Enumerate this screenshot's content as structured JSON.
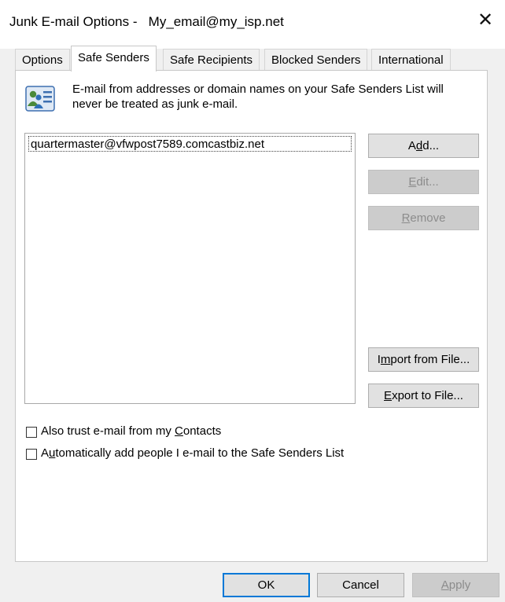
{
  "window": {
    "title": "Junk E-mail Options -   My_email@my_isp.net",
    "close_glyph": "✕"
  },
  "tabs": [
    {
      "label": "Options",
      "active": false
    },
    {
      "label": "Safe Senders",
      "active": true
    },
    {
      "label": "Safe Recipients",
      "active": false
    },
    {
      "label": "Blocked Senders",
      "active": false
    },
    {
      "label": "International",
      "active": false
    }
  ],
  "panel": {
    "description": "E-mail from addresses or domain names on your Safe Senders List will never be treated as junk e-mail.",
    "icon": "address-book-icon",
    "safe_senders": [
      "quartermaster@vfwpost7589.comcastbiz.net"
    ],
    "buttons": {
      "add": {
        "pre": "A",
        "key": "d",
        "post": "d...",
        "enabled": true
      },
      "edit": {
        "pre": "",
        "key": "E",
        "post": "dit...",
        "enabled": false
      },
      "remove": {
        "pre": "",
        "key": "R",
        "post": "emove",
        "enabled": false
      },
      "import": {
        "pre": "I",
        "key": "m",
        "post": "port from File...",
        "enabled": true
      },
      "export": {
        "pre": "",
        "key": "E",
        "post": "xport to File...",
        "enabled": true
      }
    },
    "options": {
      "trust_contacts": {
        "pre": "Also trust e-mail from my ",
        "key": "C",
        "post": "ontacts",
        "checked": false
      },
      "auto_add": {
        "pre": "A",
        "key": "u",
        "post": "tomatically add people I e-mail to the Safe Senders List",
        "checked": false
      }
    }
  },
  "footer": {
    "ok": "OK",
    "cancel": "Cancel",
    "apply": {
      "pre": "",
      "key": "A",
      "post": "pply",
      "enabled": false
    }
  },
  "colors": {
    "window_bg": "#f0f0f0",
    "panel_bg": "#ffffff",
    "default_button_border": "#0078d7",
    "disabled_text": "#8c8c8c"
  }
}
